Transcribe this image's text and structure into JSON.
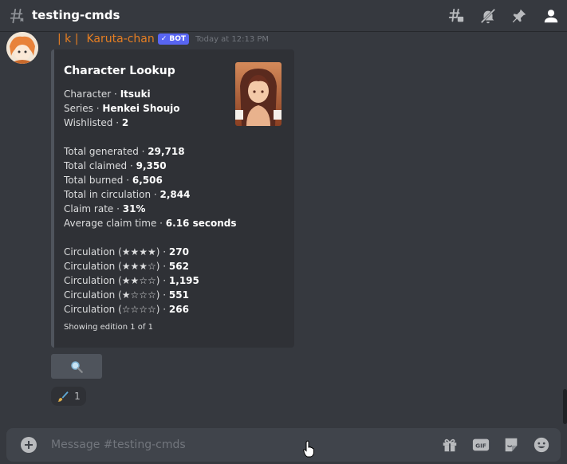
{
  "header": {
    "channel": "testing-cmds"
  },
  "message": {
    "name_prefix": "| k |",
    "author": "Karuta-chan",
    "bot_tag": "✓ BOT",
    "timestamp": "Today at 12:13 PM",
    "author_color": "#e67e22"
  },
  "embed": {
    "title": "Character Lookup",
    "lines": {
      "character": {
        "label": "Character · ",
        "value": "Itsuki"
      },
      "series": {
        "label": "Series · ",
        "value": "Henkei Shoujo"
      },
      "wishlisted": {
        "label": "Wishlisted · ",
        "value": "2"
      },
      "generated": {
        "label": "Total generated · ",
        "value": "29,718"
      },
      "claimed": {
        "label": "Total claimed · ",
        "value": "9,350"
      },
      "burned": {
        "label": "Total burned · ",
        "value": "6,506"
      },
      "circulation": {
        "label": "Total in circulation · ",
        "value": "2,844"
      },
      "claim_rate": {
        "label": "Claim rate · ",
        "value": "31%"
      },
      "avg_claim": {
        "label": "Average claim time · ",
        "value": "6.16 seconds"
      },
      "circ4": {
        "label": "Circulation (★★★★) · ",
        "value": "270"
      },
      "circ3": {
        "label": "Circulation (★★★☆) · ",
        "value": "562"
      },
      "circ2": {
        "label": "Circulation (★★☆☆) · ",
        "value": "1,195"
      },
      "circ1": {
        "label": "Circulation (★☆☆☆) · ",
        "value": "551"
      },
      "circ0": {
        "label": "Circulation (☆☆☆☆) · ",
        "value": "266"
      }
    },
    "footer": "Showing edition 1 of 1"
  },
  "button": {
    "icon": "magnifier-icon"
  },
  "reaction": {
    "icon": "paintbrush-icon",
    "count": "1"
  },
  "composer": {
    "placeholder": "Message #testing-cmds"
  },
  "colors": {
    "background": "#36393f",
    "embed_bg": "#2f3136",
    "blurple": "#5865f2"
  }
}
